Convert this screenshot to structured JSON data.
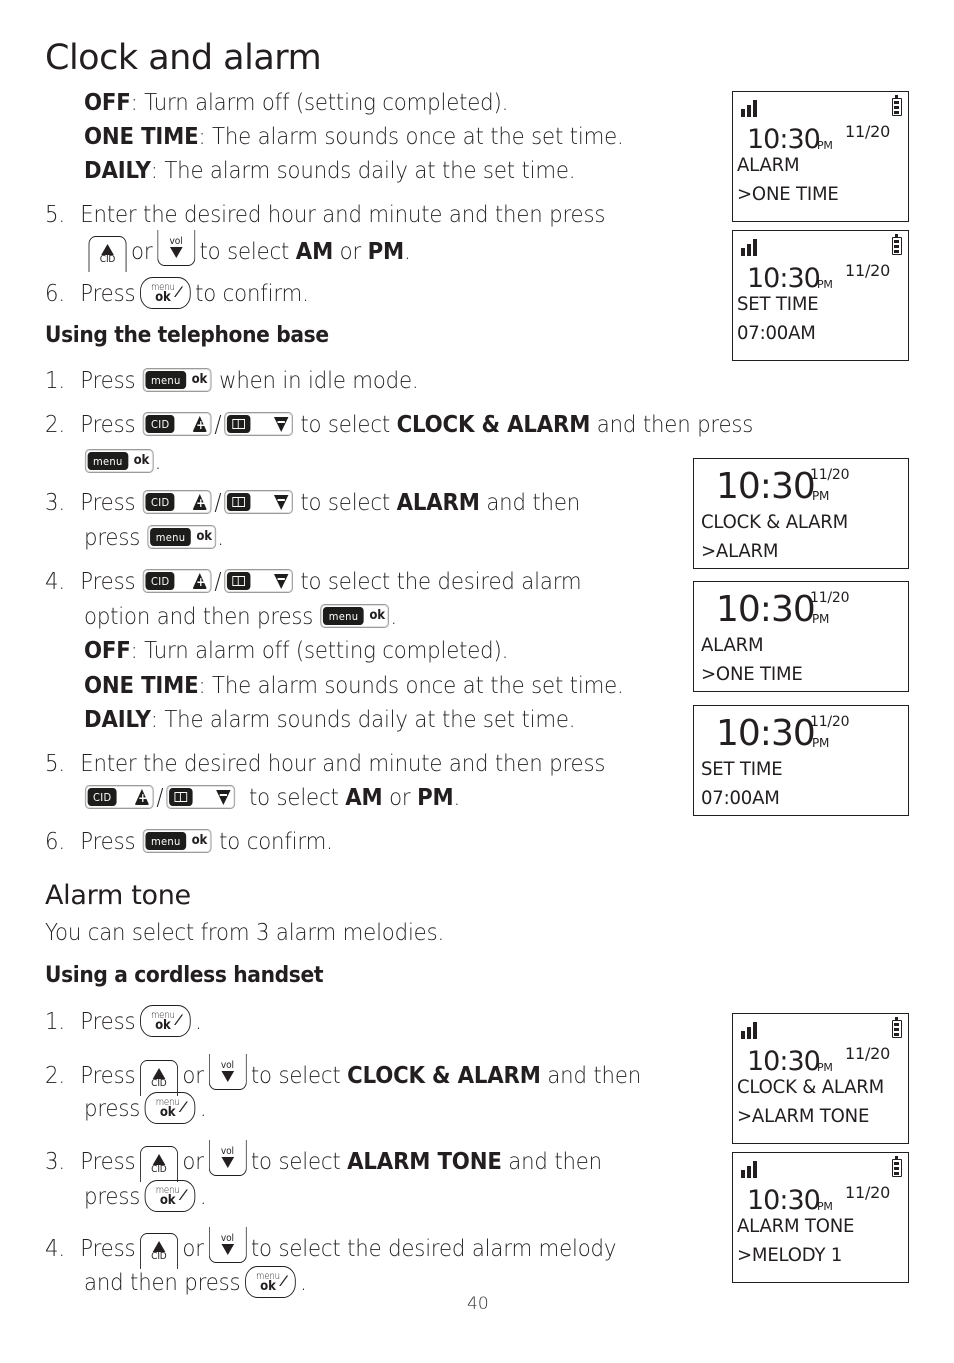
{
  "page_title": "Clock and alarm",
  "handset_continued": {
    "options": [
      {
        "term": "OFF",
        "desc": ": Turn alarm off (setting completed)."
      },
      {
        "term": "ONE TIME",
        "desc": ": The alarm sounds once at the set time."
      },
      {
        "term": "DAILY",
        "desc": ": The alarm sounds daily at the set time."
      }
    ],
    "step5": {
      "num": "5.",
      "line1": "Enter the desired hour and minute and then press",
      "or": "or",
      "to_select": "to select",
      "am": "AM",
      "or2": "or",
      "pm": "PM",
      "period": "."
    },
    "step6": {
      "num": "6.",
      "press": "Press",
      "rest": "to confirm."
    }
  },
  "base_section": {
    "heading": "Using the telephone base",
    "steps": [
      {
        "num": "1.",
        "press": "Press",
        "rest": "when in idle mode."
      },
      {
        "num": "2.",
        "press": "Press",
        "pre": "to select",
        "bold": "CLOCK & ALARM",
        "post": "and then press",
        "end": "."
      },
      {
        "num": "3.",
        "press": "Press",
        "pre": "to select",
        "bold": "ALARM",
        "post": "and then",
        "line2": "press",
        "end": "."
      },
      {
        "num": "4.",
        "press": "Press",
        "rest": "to select the desired alarm",
        "line2": "option and then press",
        "end": "."
      },
      {
        "num": "5.",
        "line1": "Enter the desired hour and minute and then press",
        "to_select": "to select",
        "am": "AM",
        "or": "or",
        "pm": "PM",
        "end": "."
      },
      {
        "num": "6.",
        "press": "Press",
        "rest": "to confirm."
      }
    ],
    "options": [
      {
        "term": "OFF",
        "desc": ": Turn alarm off (setting completed)."
      },
      {
        "term": "ONE TIME",
        "desc": ": The alarm sounds once at the set time."
      },
      {
        "term": "DAILY",
        "desc": ": The alarm sounds daily at the set time."
      }
    ]
  },
  "alarm_tone": {
    "heading": "Alarm tone",
    "intro": "You can select from 3 alarm melodies.",
    "subheading": "Using a cordless handset",
    "steps": [
      {
        "num": "1.",
        "press": "Press",
        "end": "."
      },
      {
        "num": "2.",
        "press": "Press",
        "or": "or",
        "pre": "to select",
        "bold": "CLOCK & ALARM",
        "post": "and then",
        "line2": "press",
        "end": "."
      },
      {
        "num": "3.",
        "press": "Press",
        "or": "or",
        "pre": "to select",
        "bold": "ALARM TONE",
        "post": "and then",
        "line2": "press",
        "end": "."
      },
      {
        "num": "4.",
        "press": "Press",
        "or": "or",
        "rest": "to select the desired alarm melody",
        "line2": "and then press",
        "end": "."
      }
    ]
  },
  "keys": {
    "cid": "CID",
    "vol": "vol",
    "menu": "menu",
    "ok": "ok",
    "slash": "/"
  },
  "lcd_screens": {
    "handset": [
      {
        "time": "10:30",
        "ampm": "PM",
        "date": "11/20",
        "line1": "ALARM",
        "line2": ">ONE TIME"
      },
      {
        "time": "10:30",
        "ampm": "PM",
        "date": "11/20",
        "line1": "SET TIME",
        "line2": "07:00AM"
      },
      {
        "time": "10:30",
        "ampm": "PM",
        "date": "11/20",
        "line1": "CLOCK & ALARM",
        "line2": ">ALARM TONE"
      },
      {
        "time": "10:30",
        "ampm": "PM",
        "date": "11/20",
        "line1": "ALARM TONE",
        "line2": ">MELODY 1"
      }
    ],
    "base": [
      {
        "time": "10:30",
        "ampm": "PM",
        "date": "11/20",
        "line1": "CLOCK & ALARM",
        "line2": ">ALARM"
      },
      {
        "time": "10:30",
        "ampm": "PM",
        "date": "11/20",
        "line1": "ALARM",
        "line2": ">ONE TIME"
      },
      {
        "time": "10:30",
        "ampm": "PM",
        "date": "11/20",
        "line1": "SET TIME",
        "line2": "07:00AM"
      }
    ]
  },
  "page_number": "40"
}
